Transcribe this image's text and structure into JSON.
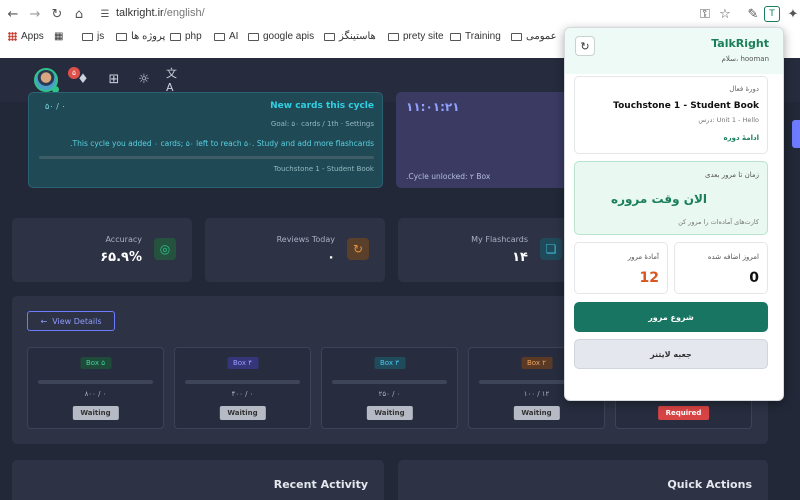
{
  "browser": {
    "url_host": "talkright.ir",
    "url_path": "/english/",
    "bookmarks": [
      {
        "label": "Apps",
        "icon": "apps-grid-icon"
      },
      {
        "label": "js",
        "icon": "folder-icon"
      },
      {
        "label": "پروژه ها",
        "icon": "folder-icon"
      },
      {
        "label": "php",
        "icon": "folder-icon"
      },
      {
        "label": "AI",
        "icon": "folder-icon"
      },
      {
        "label": "google apis",
        "icon": "folder-icon"
      },
      {
        "label": "هاستینگز",
        "icon": "folder-icon"
      },
      {
        "label": "prety site",
        "icon": "folder-icon"
      },
      {
        "label": "Training",
        "icon": "folder-icon"
      },
      {
        "label": "عمومی",
        "icon": "folder-icon"
      }
    ]
  },
  "header": {
    "notification_count": "۵"
  },
  "cycle": {
    "title": "New cards this cycle",
    "progress": "۵۰ / ۰",
    "goal": "Goal: ۵۰ cards / 1th · Settings",
    "message": ".This cycle you added ۰ cards; ۵۰ left to reach ۵۰. Study and add more flashcards",
    "book": "Touchstone 1 - Student Book",
    "progress_fraction": 0
  },
  "timer": {
    "value": "۱۱:۰۱:۲۱",
    "note": ".Cycle unlocked: ۲ Box"
  },
  "stats": [
    {
      "label": "Accuracy",
      "value": "۶۵.۹%",
      "icon": "target-icon",
      "color": "#2ec58a"
    },
    {
      "label": "Reviews Today",
      "value": "۰",
      "icon": "refresh-icon",
      "color": "#e8903a"
    },
    {
      "label": "My Flashcards",
      "value": "۱۴",
      "icon": "cards-icon",
      "color": "#3fb7d4"
    }
  ],
  "boxes": {
    "view_details": "View Details",
    "items": [
      {
        "label": "Box ۵",
        "count": "۸۰۰ / ۰",
        "status": "Waiting",
        "color": "#2a9d6d"
      },
      {
        "label": "Box ۴",
        "count": "۴۰۰ / ۰",
        "status": "Waiting",
        "color": "#5b5bd6"
      },
      {
        "label": "Box ۳",
        "count": "۲۵۰ / ۰",
        "status": "Waiting",
        "color": "#2a91b5"
      },
      {
        "label": "Box ۲",
        "count": "۱۰۰ / ۱۲",
        "status": "Waiting",
        "color": "#c8682a"
      }
    ],
    "required_label": "Required"
  },
  "sections": {
    "recent_activity": "Recent Activity",
    "quick_actions": "Quick Actions"
  },
  "popup": {
    "brand": "TalkRight",
    "greeting": "سلام، hooman",
    "active_course_label": "دورهٔ فعال",
    "course_name": "Touchstone 1 - Student Book",
    "lesson": "درس: Unit 1 - Hello",
    "continue_label": "ادامهٔ دوره",
    "next_review_label": "زمان تا مرور بعدی",
    "next_review_value": "الان وقت مروره",
    "next_review_sub": "کارت‌های آماده‌ات را مرور کن",
    "ready_label": "آمادهٔ مرور",
    "ready_value": "12",
    "added_today_label": "امروز اضافه شده",
    "added_today_value": "0",
    "start_review": "شروع مرور",
    "leitner_box": "جعبه لایتنر"
  }
}
